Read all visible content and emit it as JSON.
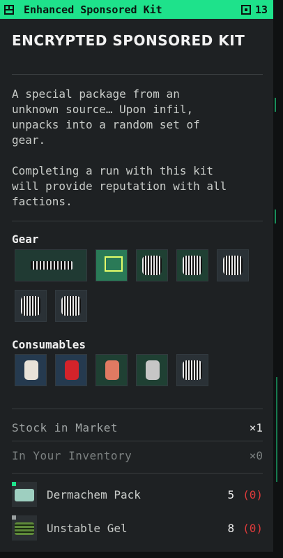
{
  "header": {
    "title": "Enhanced Sponsored Kit",
    "count": "13",
    "accent": "#1ee28b"
  },
  "item": {
    "name": "ENCRYPTED SPONSORED KIT",
    "description_1": "A special package from an\nunknown source… Upon infil,\nunpacks into a random set of\ngear.",
    "description_2": "Completing a run with this kit\nwill provide reputation with all\nfactions."
  },
  "sections": {
    "gear": "Gear",
    "consumables": "Consumables"
  },
  "stats": {
    "stock_label": "Stock in Market",
    "stock_value": "×1",
    "inventory_label": "In Your Inventory",
    "inventory_value": "×0"
  },
  "requirements": [
    {
      "name": "Dermachem Pack",
      "qty": "5",
      "have": "(0)",
      "marker_color": "#1ee28b"
    },
    {
      "name": "Unstable Gel",
      "qty": "8",
      "have": "(0)",
      "marker_color": "#9aa0a0"
    }
  ],
  "icons": {
    "header_icon": "grid-icon",
    "count_icon": "item-count-icon"
  }
}
